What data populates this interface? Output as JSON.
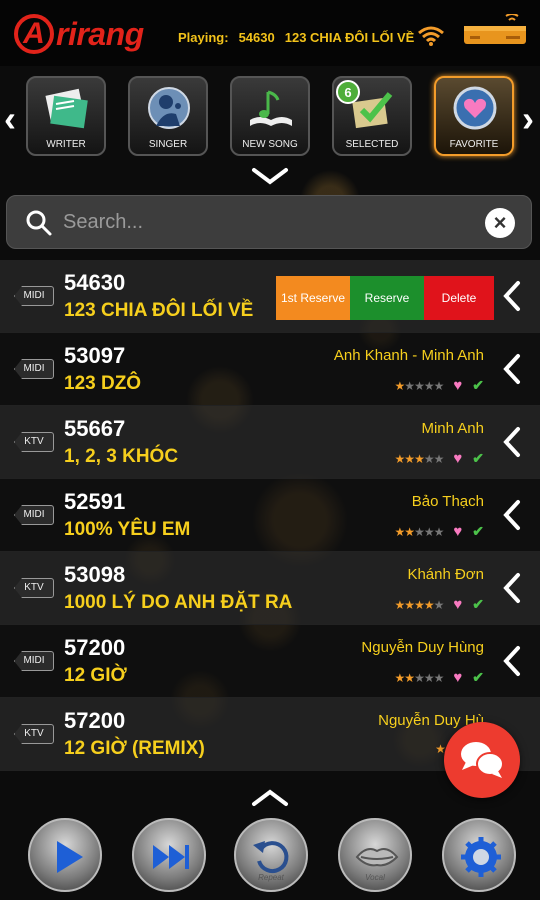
{
  "app": {
    "logo_letter": "A",
    "logo_text": "rirang"
  },
  "header": {
    "playing_label": "Playing:",
    "playing_number": "54630",
    "playing_title": "123 CHIA ĐÔI LỐI VỀ"
  },
  "categories": [
    {
      "label": "WRITER",
      "icon": "writer-icon"
    },
    {
      "label": "SINGER",
      "icon": "singer-icon"
    },
    {
      "label": "NEW SONG",
      "icon": "new-song-icon"
    },
    {
      "label": "SELECTED",
      "icon": "selected-icon",
      "badge": "6"
    },
    {
      "label": "FAVORITE",
      "icon": "favorite-icon",
      "active": true
    }
  ],
  "search": {
    "placeholder": "Search...",
    "clear_label": "×"
  },
  "row_actions": {
    "first_reserve": "1st Reserve",
    "reserve": "Reserve",
    "delete": "Delete"
  },
  "songs": [
    {
      "type": "MIDI",
      "number": "54630",
      "title": "123 CHIA ĐÔI LỐI VỀ",
      "singer": "",
      "stars": 0
    },
    {
      "type": "MIDI",
      "number": "53097",
      "title": "123 DZÔ",
      "singer": "Anh Khanh - Minh Anh",
      "stars": 1
    },
    {
      "type": "KTV",
      "number": "55667",
      "title": "1, 2, 3 KHÓC",
      "singer": "Minh Anh",
      "stars": 3
    },
    {
      "type": "MIDI",
      "number": "52591",
      "title": "100% YÊU EM",
      "singer": "Bảo Thạch",
      "stars": 2
    },
    {
      "type": "KTV",
      "number": "53098",
      "title": "1000 LÝ DO ANH ĐẶT RA",
      "singer": "Khánh Đơn",
      "stars": 4
    },
    {
      "type": "MIDI",
      "number": "57200",
      "title": "12 GIỜ",
      "singer": "Nguyễn Duy Hùng",
      "stars": 2
    },
    {
      "type": "KTV",
      "number": "57200",
      "title": "12 GIỜ (REMIX)",
      "singer": "Nguyễn Duy Hù",
      "stars": 2
    }
  ],
  "controls": [
    {
      "label": "",
      "icon": "play-icon"
    },
    {
      "label": "",
      "icon": "next-icon"
    },
    {
      "label": "Repeat",
      "icon": "repeat-icon"
    },
    {
      "label": "Vocal",
      "icon": "lips-icon"
    },
    {
      "label": "",
      "icon": "settings-icon"
    }
  ],
  "colors": {
    "accent_yellow": "#f6cf1d",
    "brand_red": "#e2231a",
    "reserve_orange": "#f38a1f",
    "reserve_green": "#1c8f2c",
    "delete_red": "#e0131b"
  }
}
